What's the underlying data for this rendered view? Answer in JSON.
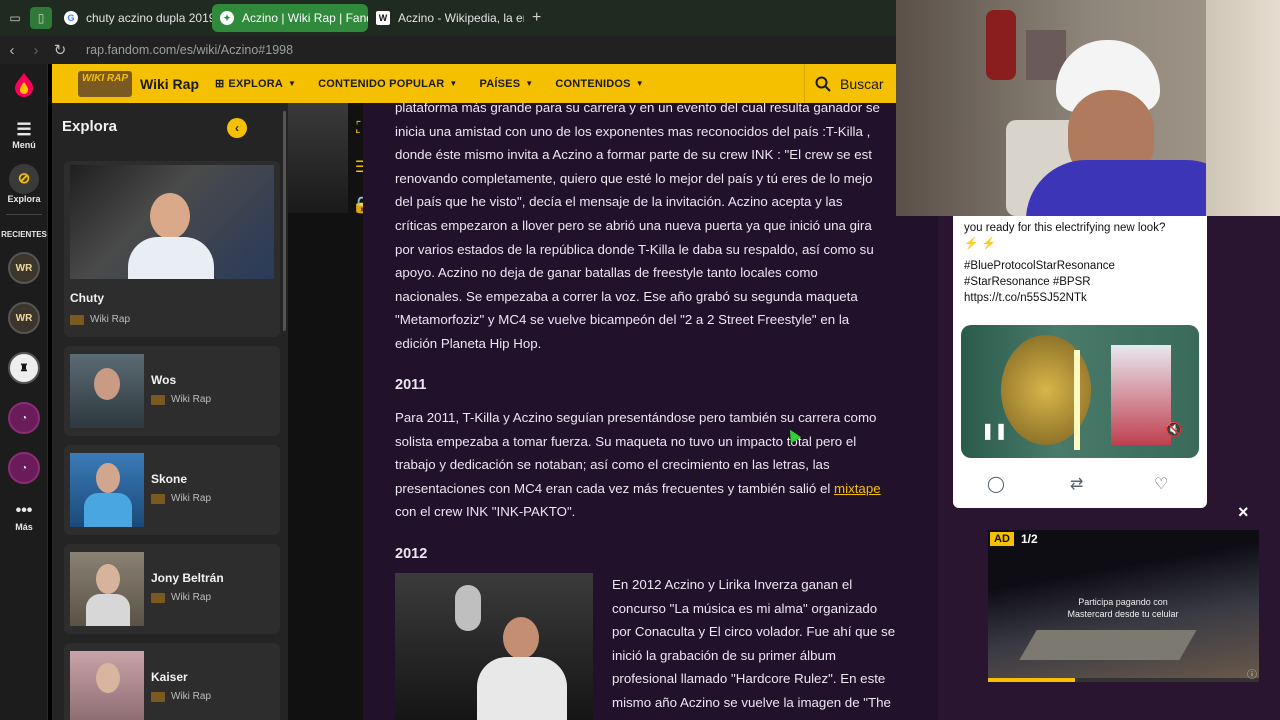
{
  "browser": {
    "tabs": [
      {
        "label": "chuty aczino dupla 2019 -",
        "icon": "google-icon",
        "active": false
      },
      {
        "label": "Aczino | Wiki Rap | Fando",
        "icon": "fandom-icon",
        "active": true
      },
      {
        "label": "Aczino - Wikipedia, la enc",
        "icon": "wikipedia-icon",
        "active": false
      }
    ],
    "new_tab": "+",
    "url": "rap.fandom.com/es/wiki/Aczino#1998"
  },
  "rail": {
    "menu_label": "Menú",
    "explora_label": "Explora",
    "recientes_label": "RECIENTES",
    "mas_label": "Más"
  },
  "header": {
    "logo_text": "WIKI RAP",
    "wiki_name": "Wiki Rap",
    "nav": [
      "EXPLORA",
      "CONTENIDO POPULAR",
      "PAÍSES",
      "CONTENIDOS"
    ],
    "search_label": "Buscar"
  },
  "explora": {
    "title": "Explora",
    "cards": [
      {
        "name": "Chuty",
        "wiki": "Wiki Rap"
      },
      {
        "name": "Wos",
        "wiki": "Wiki Rap"
      },
      {
        "name": "Skone",
        "wiki": "Wiki Rap"
      },
      {
        "name": "Jony Beltrán",
        "wiki": "Wiki Rap"
      },
      {
        "name": "Kaiser",
        "wiki": "Wiki Rap"
      }
    ]
  },
  "article": {
    "p1_lines": [
      "plataforma más grande para su carrera y en un evento del cual resulta ganador se",
      "inicia una amistad con uno de los exponentes mas reconocidos del país :T-Killa ,",
      "donde éste mismo invita a Aczino a formar parte de su crew INK : \"El crew se est",
      "renovando completamente, quiero que esté lo mejor del país y tú eres de lo mejo",
      "del país que he visto\", decía el mensaje de la invitación. Aczino acepta y las",
      "críticas empezaron a llover pero se abrió una nueva puerta ya que inició una gira",
      "por varios estados de la república donde T-Killa le daba su respaldo, así como su",
      "apoyo. Aczino no deja de ganar batallas de freestyle tanto locales como",
      "nacionales. Se empezaba a correr la voz. Ese año grabó su segunda maqueta",
      "\"Metamorfoziz\" y MC4 se vuelve bicampeón del \"2 a 2 Street Freestyle\" en la",
      "edición Planeta Hip Hop."
    ],
    "h2011": "2011",
    "p2_lines": [
      "Para 2011, T-Killa y Aczino seguían presentándose pero también su carrera como",
      "solista empezaba a tomar fuerza. Su maqueta no tuvo un impacto total pero el",
      "trabajo y dedicación se notaban; así como el crecimiento en las letras, las",
      "presentaciones con MC4 eran cada vez más frecuentes y también salió el"
    ],
    "p2_link": "mixtape",
    "p2_last": "con el crew INK \"INK-PAKTO\".",
    "h2012": "2012",
    "p3_lines": [
      "En 2012 Aczino y Lirika Inverza ganan el",
      "concurso \"La música es mi alma\" organizado",
      "por Conaculta y El circo volador. Fue ahí que se",
      "inició la grabación de su primer álbum",
      "profesional llamado \"Hardcore Rulez\". En este",
      "mismo año Aczino se vuelve la imagen de \"The"
    ]
  },
  "tweet": {
    "partial_line": "you ready for this electrifying new look?",
    "emoji": "⚡ ⚡",
    "tags": [
      "#BlueProtocolStarResonance",
      "#StarResonance #BPSR"
    ],
    "link": "https://t.co/n55SJ52NTk"
  },
  "ad": {
    "badge": "AD",
    "count": "1/2",
    "text_line1": "Participa pagando con",
    "text_line2": "Mastercard desde tu celular",
    "close": "×"
  },
  "colors": {
    "accent": "#f5c000",
    "article_bg": "#22112a"
  }
}
